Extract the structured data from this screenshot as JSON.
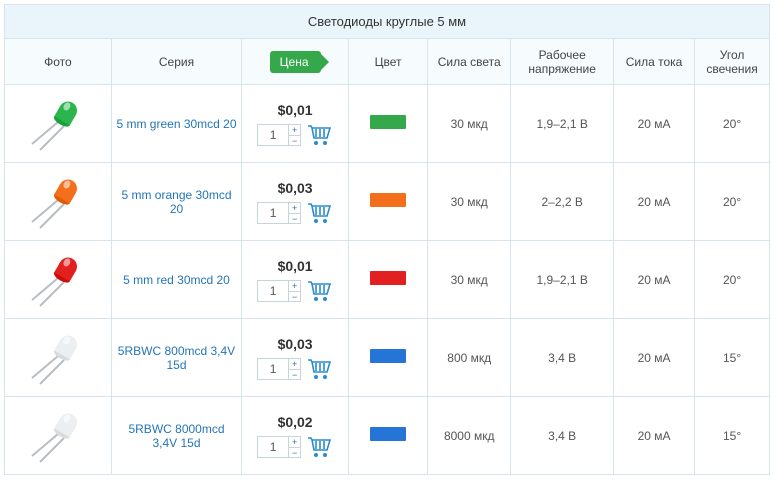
{
  "title": "Светодиоды круглые 5 мм",
  "headers": {
    "photo": "Фото",
    "series": "Серия",
    "price": "Цена",
    "color": "Цвет",
    "luminous": "Сила света",
    "voltage": "Рабочее напряжение",
    "current": "Сила тока",
    "angle": "Угол свечения"
  },
  "rows": [
    {
      "series": "5 mm green 30mcd 20",
      "price": "$0,01",
      "qty": "1",
      "swatch": "#34a84a",
      "led_color": "#2bb54c",
      "luminous": "30 мкд",
      "voltage": "1,9–2,1 В",
      "current": "20 мА",
      "angle": "20°"
    },
    {
      "series": "5 mm orange 30mcd 20",
      "price": "$0,03",
      "qty": "1",
      "swatch": "#f36f1c",
      "led_color": "#f36f1c",
      "luminous": "30 мкд",
      "voltage": "2–2,2 В",
      "current": "20 мА",
      "angle": "20°"
    },
    {
      "series": "5 mm red 30mcd 20",
      "price": "$0,01",
      "qty": "1",
      "swatch": "#e22020",
      "led_color": "#e22020",
      "luminous": "30 мкд",
      "voltage": "1,9–2,1 В",
      "current": "20 мА",
      "angle": "20°"
    },
    {
      "series": "5RBWC 800mcd 3,4V 15d",
      "price": "$0,03",
      "qty": "1",
      "swatch": "#2575d6",
      "led_color": "#eceff1",
      "luminous": "800 мкд",
      "voltage": "3,4 В",
      "current": "20 мА",
      "angle": "15°"
    },
    {
      "series": "5RBWC 8000mcd 3,4V 15d",
      "price": "$0,02",
      "qty": "1",
      "swatch": "#2575d6",
      "led_color": "#eceff1",
      "luminous": "8000 мкд",
      "voltage": "3,4 В",
      "current": "20 мА",
      "angle": "15°"
    }
  ]
}
